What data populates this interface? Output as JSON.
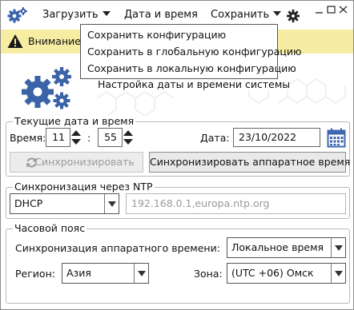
{
  "toolbar": {
    "load_label": "Загрузить",
    "datetime_label": "Дата и время",
    "save_label": "Сохранить"
  },
  "warning": {
    "text": "Внимание!"
  },
  "save_menu": {
    "items": [
      "Сохранить конфигурацию",
      "Сохранить в глобальную конфигурацию",
      "Сохранить в локальную конфигурацию"
    ]
  },
  "header": {
    "title": "Настройка даты и времени системы"
  },
  "current": {
    "legend": "Текущие дата и время",
    "time_label": "Время:",
    "hours": "11",
    "separator": ":",
    "minutes": "55",
    "date_label": "Дата:",
    "date": "23/10/2022",
    "sync_button": "Синхронизировать",
    "sync_hw_button": "Синхронизировать аппаратное время"
  },
  "ntp": {
    "legend": "Синхронизация через NTP",
    "mode": "DHCP",
    "servers_placeholder": "192.168.0.1,europa.ntp.org"
  },
  "timezone": {
    "legend": "Часовой пояс",
    "hw_sync_label": "Синхронизация аппаратного времени:",
    "hw_sync_value": "Локальное время",
    "region_label": "Регион:",
    "region_value": "Азия",
    "zone_label": "Зона:",
    "zone_value": "(UTC +06) Омск"
  },
  "colors": {
    "warning_bg": "#f6eda3",
    "icon_blue": "#3a63a8",
    "calendar_blue": "#3d67b0"
  }
}
